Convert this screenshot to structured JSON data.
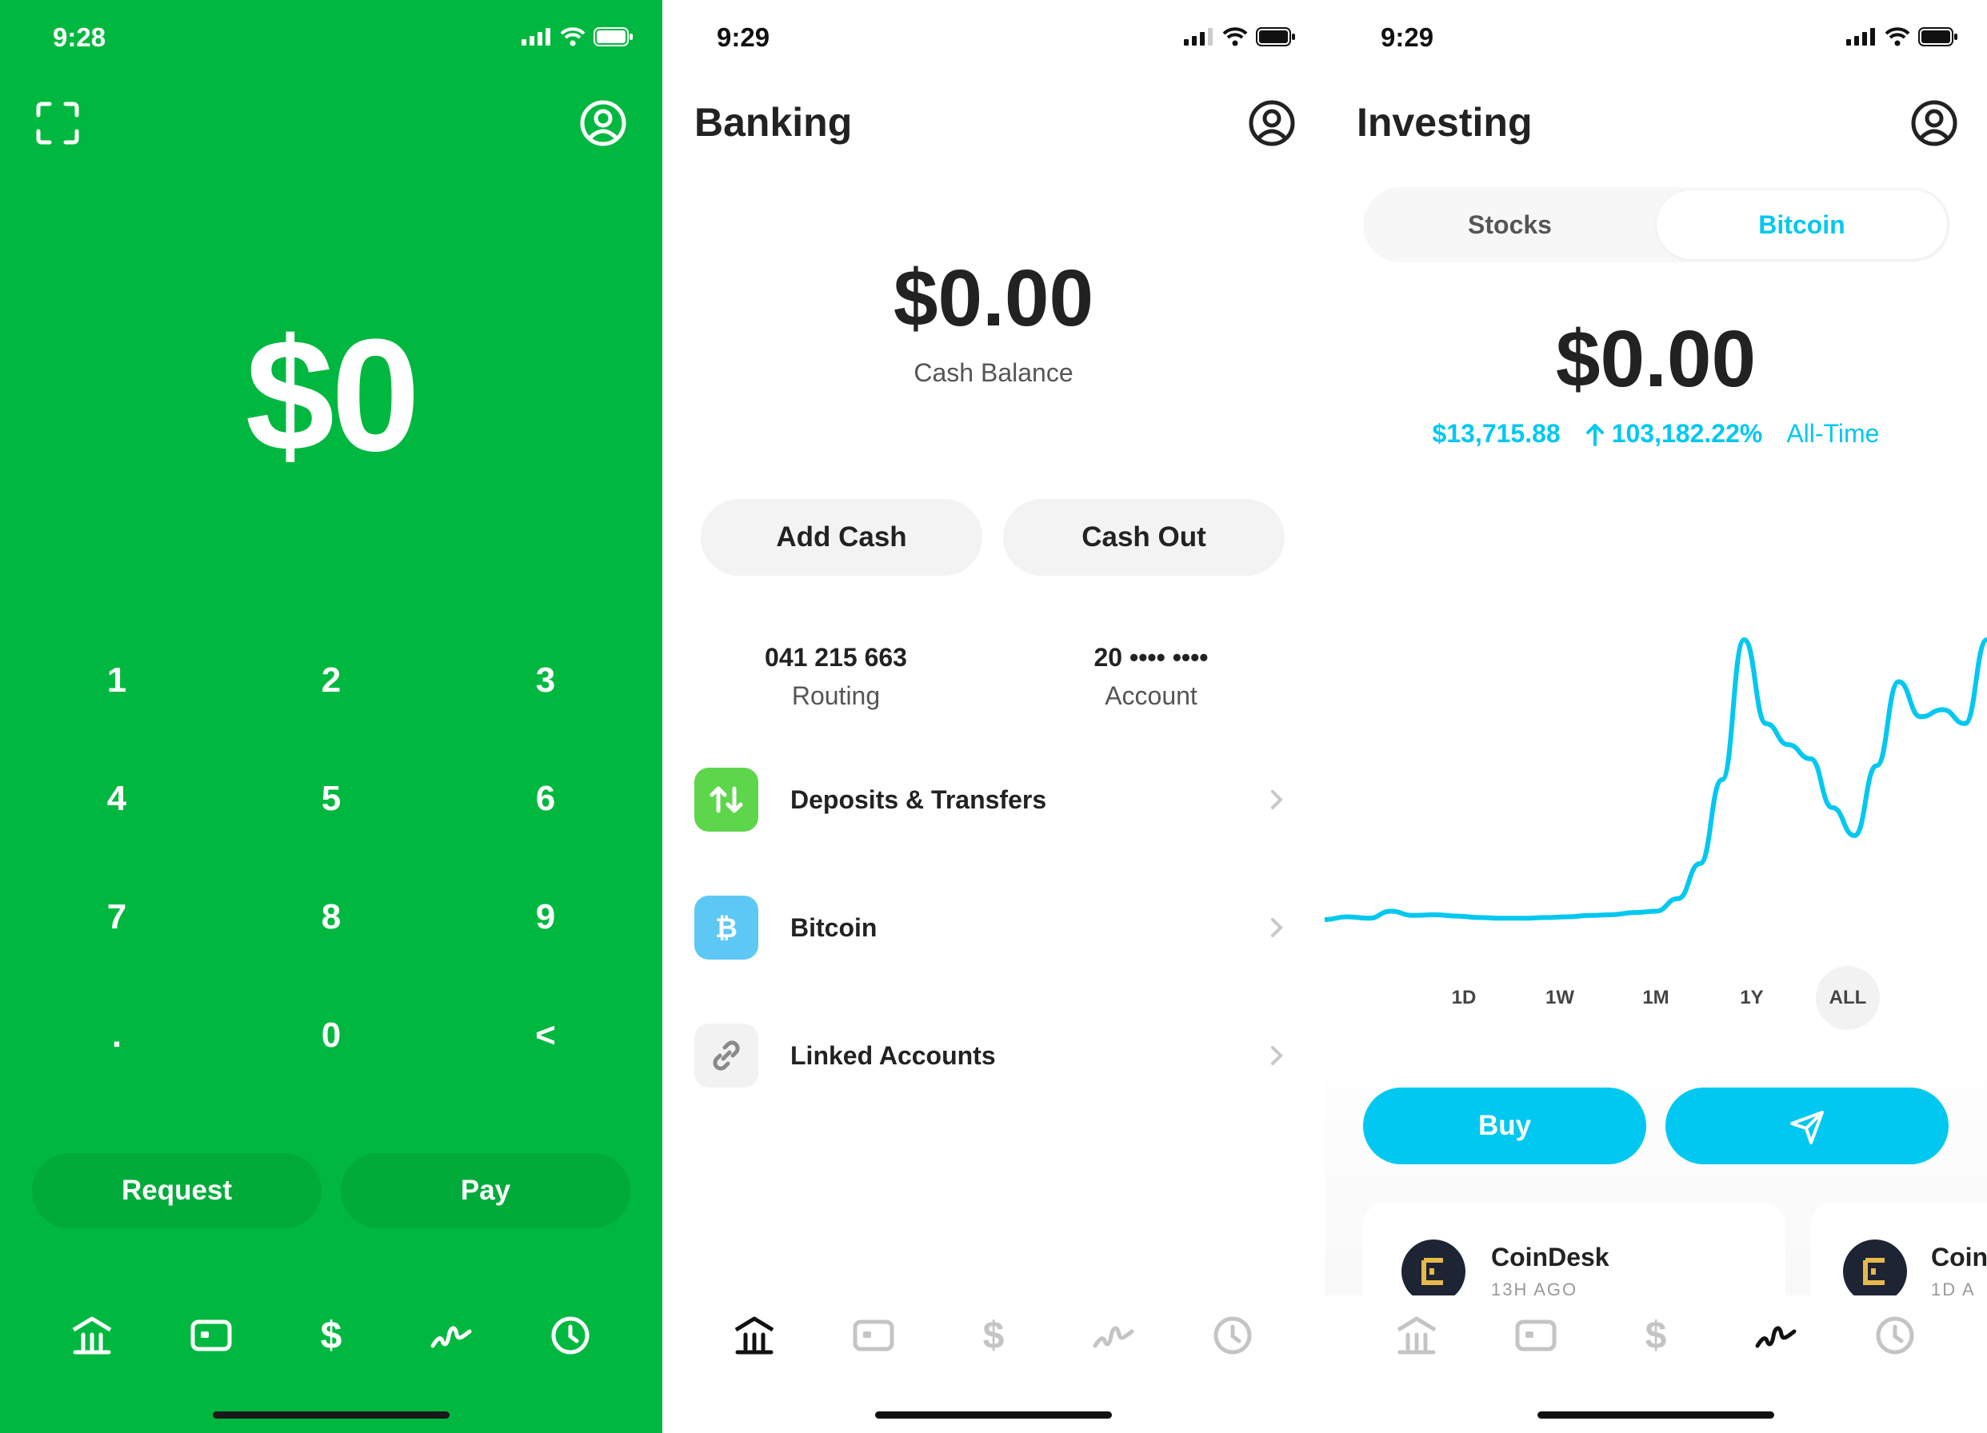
{
  "screen1": {
    "status_time": "9:28",
    "amount": "$0",
    "keypad": [
      "1",
      "2",
      "3",
      "4",
      "5",
      "6",
      "7",
      "8",
      "9",
      ".",
      "0",
      "<"
    ],
    "request_label": "Request",
    "pay_label": "Pay"
  },
  "screen2": {
    "status_time": "9:29",
    "title": "Banking",
    "balance": "$0.00",
    "balance_label": "Cash Balance",
    "add_cash_label": "Add Cash",
    "cash_out_label": "Cash Out",
    "routing_number": "041 215 663",
    "routing_label": "Routing",
    "account_number": "20 •••• ••••",
    "account_label": "Account",
    "rows": [
      {
        "label": "Deposits & Transfers",
        "icon": "transfer-arrows-icon",
        "color": "#5ed64b"
      },
      {
        "label": "Bitcoin",
        "icon": "bitcoin-icon",
        "color": "#5ec8f5"
      },
      {
        "label": "Linked Accounts",
        "icon": "link-icon",
        "color": "#f2f2f2"
      }
    ]
  },
  "screen3": {
    "status_time": "9:29",
    "title": "Investing",
    "tabs": [
      "Stocks",
      "Bitcoin"
    ],
    "selected_tab": "Bitcoin",
    "balance": "$0.00",
    "gain_value": "$13,715.88",
    "gain_percent": "103,182.22%",
    "gain_period": "All-Time",
    "ranges": [
      "1D",
      "1W",
      "1M",
      "1Y",
      "ALL"
    ],
    "selected_range": "ALL",
    "buy_label": "Buy",
    "news": [
      {
        "source": "CoinDesk",
        "time": "13H AGO"
      },
      {
        "source": "Coin",
        "time": "1D A"
      }
    ],
    "chart_data": {
      "type": "line",
      "x_range": "ALL",
      "values": [
        1.0,
        1.2,
        1.1,
        1.6,
        1.3,
        1.35,
        1.25,
        1.15,
        1.1,
        1.1,
        1.15,
        1.2,
        1.3,
        1.35,
        1.5,
        1.6,
        2.5,
        5,
        11,
        21,
        15,
        13.5,
        12.5,
        9,
        7,
        12,
        18,
        15.5,
        16,
        15,
        21
      ],
      "color": "#00c8f0"
    }
  },
  "colors": {
    "cash_green": "#00b83f",
    "cyan": "#00c8f0",
    "text_dark": "#222222"
  }
}
